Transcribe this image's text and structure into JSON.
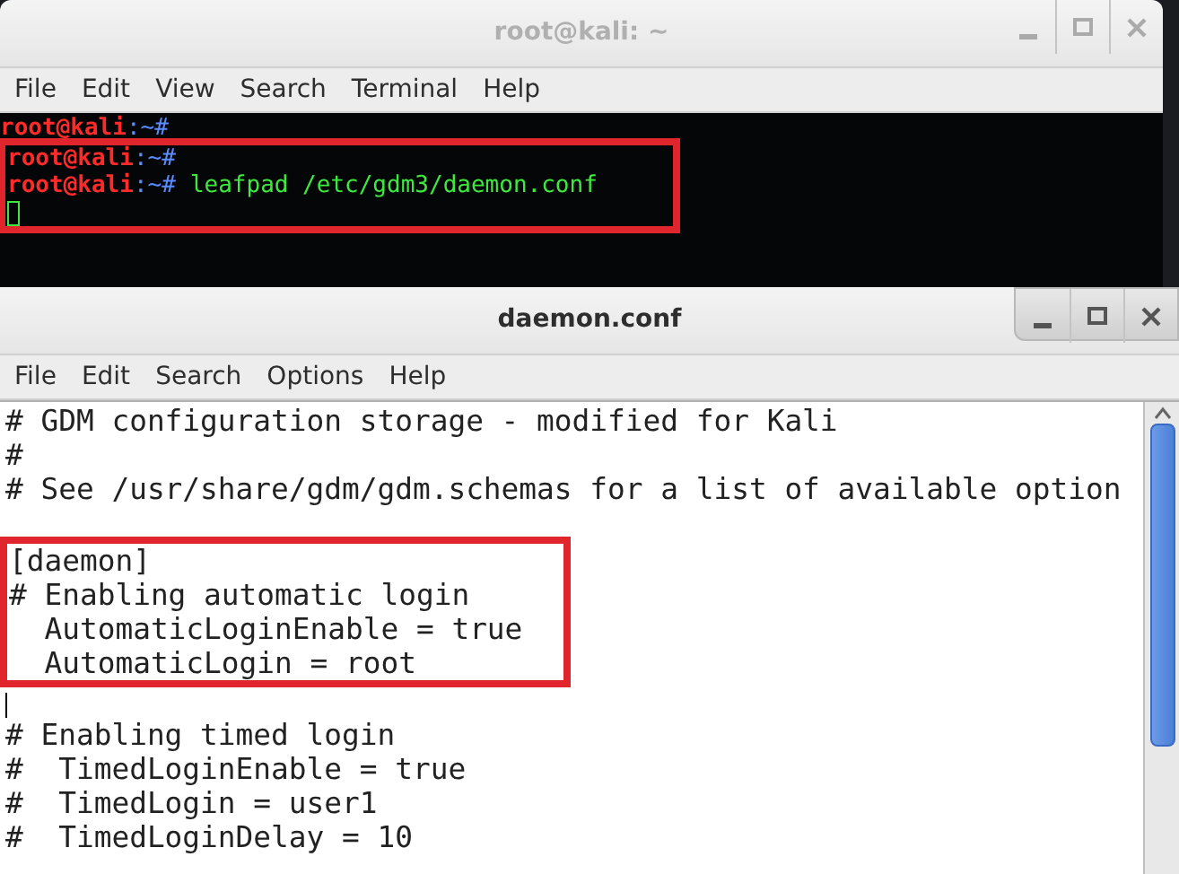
{
  "terminal": {
    "title": "root@kali: ~",
    "active": false,
    "menu": [
      "File",
      "Edit",
      "View",
      "Search",
      "Terminal",
      "Help"
    ],
    "lines": [
      {
        "kind": "prompt",
        "user": "root@kali",
        "path": ":~#",
        "highlighted": false
      },
      {
        "kind": "prompt",
        "user": "root@kali",
        "path": ":~#",
        "highlighted": true
      },
      {
        "kind": "prompt",
        "user": "root@kali",
        "path": ":~#",
        "command": "leafpad /etc/gdm3/daemon.conf",
        "highlighted": true
      },
      {
        "kind": "cursor",
        "highlighted": true
      }
    ]
  },
  "editor": {
    "title": "daemon.conf",
    "active": true,
    "menu": [
      "File",
      "Edit",
      "Search",
      "Options",
      "Help"
    ],
    "lines": [
      {
        "kind": "text",
        "text": "# GDM configuration storage - modified for Kali",
        "highlighted": false
      },
      {
        "kind": "text",
        "text": "#",
        "highlighted": false
      },
      {
        "kind": "text",
        "text": "# See /usr/share/gdm/gdm.schemas for a list of available option",
        "highlighted": false
      },
      {
        "kind": "blank",
        "highlighted": false
      },
      {
        "kind": "text",
        "text": "[daemon]",
        "highlighted": true
      },
      {
        "kind": "text",
        "text": "# Enabling automatic login",
        "highlighted": true
      },
      {
        "kind": "text",
        "text": "  AutomaticLoginEnable = true",
        "highlighted": true
      },
      {
        "kind": "text",
        "text": "  AutomaticLogin = root",
        "highlighted": true
      },
      {
        "kind": "cursor",
        "highlighted": false
      },
      {
        "kind": "text",
        "text": "# Enabling timed login",
        "highlighted": false
      },
      {
        "kind": "text",
        "text": "#  TimedLoginEnable = true",
        "highlighted": false
      },
      {
        "kind": "text",
        "text": "#  TimedLogin = user1",
        "highlighted": false
      },
      {
        "kind": "text",
        "text": "#  TimedLoginDelay = 10",
        "highlighted": false
      }
    ]
  }
}
